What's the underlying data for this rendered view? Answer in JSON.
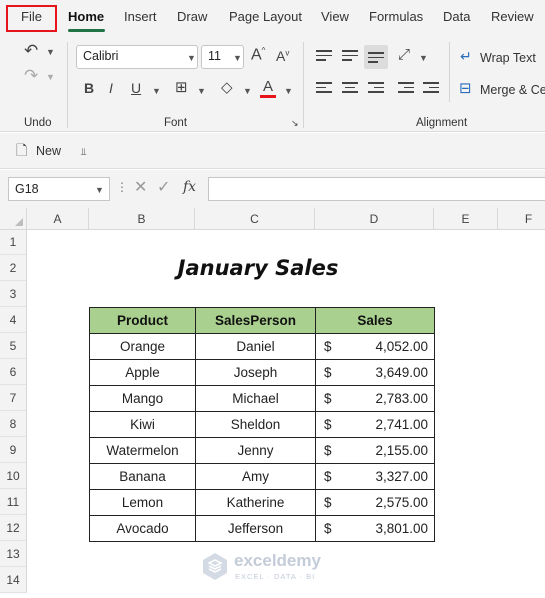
{
  "ribbon_tabs": [
    "File",
    "Home",
    "Insert",
    "Draw",
    "Page Layout",
    "View",
    "Formulas",
    "Data",
    "Review"
  ],
  "active_tab": "Home",
  "font": {
    "name": "Calibri",
    "size": "11"
  },
  "ribbon_buttons": {
    "wrap_text": "Wrap Text",
    "merge_center": "Merge & Ce"
  },
  "group_labels": {
    "undo": "Undo",
    "font": "Font",
    "alignment": "Alignment"
  },
  "quick_access": {
    "new_label": "New"
  },
  "formula_bar": {
    "name_box": "G18",
    "fx_label": "fx",
    "content": ""
  },
  "columns": [
    "A",
    "B",
    "C",
    "D",
    "E",
    "F"
  ],
  "rows": [
    "1",
    "2",
    "3",
    "4",
    "5",
    "6",
    "7",
    "8",
    "9",
    "10",
    "11",
    "12",
    "13",
    "14"
  ],
  "sheet": {
    "title": "January Sales",
    "headers": [
      "Product",
      "SalesPerson",
      "Sales"
    ],
    "currency_symbol": "$",
    "records": [
      {
        "product": "Orange",
        "salesperson": "Daniel",
        "sales": "4,052.00"
      },
      {
        "product": "Apple",
        "salesperson": "Joseph",
        "sales": "3,649.00"
      },
      {
        "product": "Mango",
        "salesperson": "Michael",
        "sales": "2,783.00"
      },
      {
        "product": "Kiwi",
        "salesperson": "Sheldon",
        "sales": "2,741.00"
      },
      {
        "product": "Watermelon",
        "salesperson": "Jenny",
        "sales": "2,155.00"
      },
      {
        "product": "Banana",
        "salesperson": "Amy",
        "sales": "3,327.00"
      },
      {
        "product": "Lemon",
        "salesperson": "Katherine",
        "sales": "2,575.00"
      },
      {
        "product": "Avocado",
        "salesperson": "Jefferson",
        "sales": "3,801.00"
      }
    ]
  },
  "watermark": {
    "name": "exceldemy",
    "tagline": "EXCEL · DATA · BI"
  },
  "colors": {
    "accent": "#217346",
    "header_fill": "#a9d08e",
    "highlight_border": "#e8141c",
    "font_color_bar": "#e8141c"
  }
}
